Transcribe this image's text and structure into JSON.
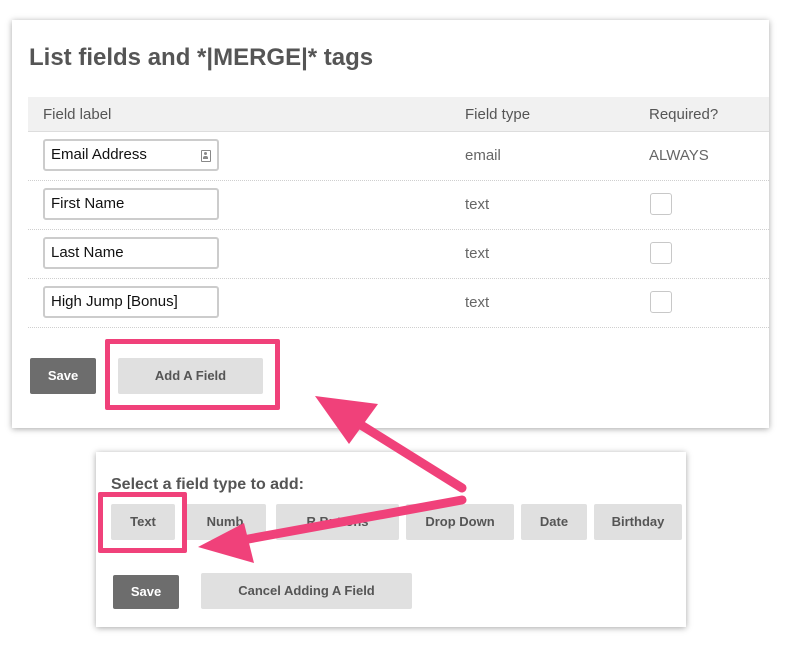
{
  "section_title": "List fields and *|MERGE|* tags",
  "table": {
    "headers": [
      "Field label",
      "Field type",
      "Required?"
    ],
    "rows": [
      {
        "label": "Email Address",
        "type": "email",
        "required": "ALWAYS",
        "icon": "contact-card-icon"
      },
      {
        "label": "First Name",
        "type": "text",
        "required": false
      },
      {
        "label": "Last Name",
        "type": "text",
        "required": false
      },
      {
        "label": "High Jump [Bonus]",
        "type": "text",
        "required": false
      }
    ]
  },
  "actions": {
    "save_label": "Save",
    "add_field_label": "Add A Field"
  },
  "add_field_panel": {
    "prompt": "Select a field type to add:",
    "field_types": [
      "Text",
      "Numb",
      "R Buttons",
      "Drop Down",
      "Date",
      "Birthday"
    ],
    "save_label": "Save",
    "cancel_label": "Cancel Adding A Field"
  },
  "colors": {
    "highlight": "#f0417a",
    "dark_button": "#6d6d6d",
    "light_button": "#e0e0e0"
  }
}
